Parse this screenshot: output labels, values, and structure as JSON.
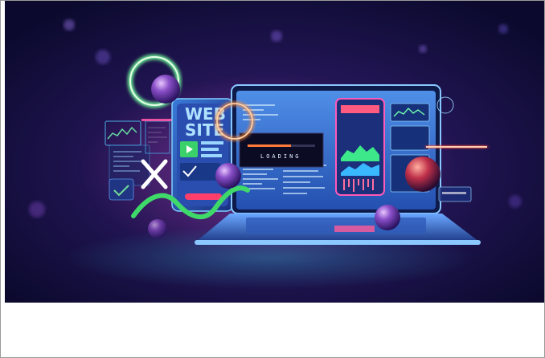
{
  "illustration": {
    "phone_label_line1": "WEB",
    "phone_label_line2": "SITE",
    "loading_text": "LOADING"
  },
  "caption": {
    "text": ""
  },
  "colors": {
    "background_dark": "#0d0b3a",
    "background_glow": "#5b2a8e",
    "neon_cyan": "#3ff0ff",
    "neon_pink": "#ff3fa8",
    "neon_orange": "#ff6a2a",
    "neon_green": "#39d86b",
    "screen_blue": "#2f6fd8"
  }
}
